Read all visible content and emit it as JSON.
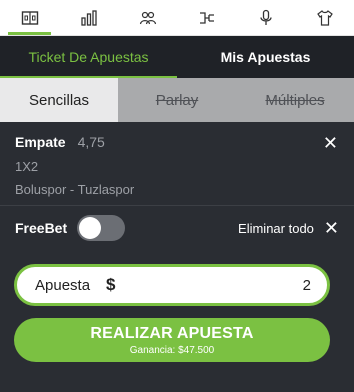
{
  "colors": {
    "accent": "#7bc142",
    "panel_bg": "#2a2d33",
    "tab_bg": "#1f2227",
    "bet_types_bg": "#a9aaac"
  },
  "toolbar": {
    "icons": [
      "scoreboard-icon",
      "stats-icon",
      "lineups-icon",
      "bracket-icon",
      "microphone-icon",
      "shirt-icon"
    ]
  },
  "ticket_tabs": {
    "active": "Ticket De Apuestas",
    "inactive": "Mis Apuestas"
  },
  "bet_types": {
    "singles": "Sencillas",
    "parlay": "Parlay",
    "multiples": "Múltiples"
  },
  "selection": {
    "market": "Empate",
    "odds": "4,75",
    "type": "1X2",
    "match": "Boluspor - Tuzlaspor"
  },
  "freebet": {
    "label": "FreeBet",
    "enabled": false,
    "clear_all": "Eliminar todo"
  },
  "stake": {
    "label": "Apuesta",
    "currency": "$",
    "value": "2"
  },
  "place_bet": {
    "label": "REALIZAR APUESTA",
    "winnings": "Ganancia: $47.500"
  }
}
